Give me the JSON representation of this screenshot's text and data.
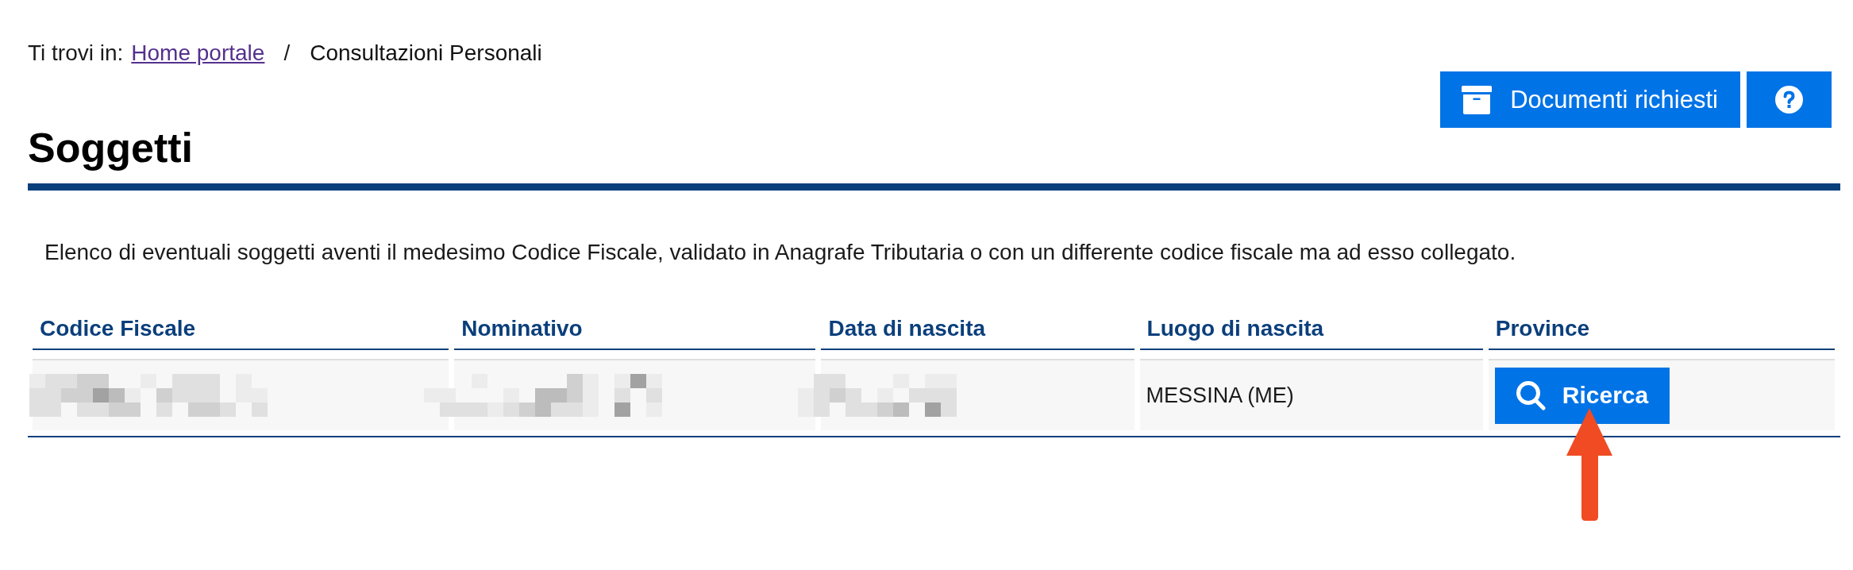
{
  "breadcrumb": {
    "prefix": "Ti trovi in:",
    "separator": "/",
    "items": [
      {
        "kind": "link",
        "label": "Home portale"
      },
      {
        "kind": "current",
        "label": "Consultazioni Personali"
      }
    ]
  },
  "actions": [
    {
      "kind": "documents",
      "label": "Documenti richiesti"
    },
    {
      "kind": "help"
    }
  ],
  "title": "Soggetti",
  "description": "Elenco di eventuali soggetti aventi il medesimo Codice Fiscale, validato in Anagrafe Tributaria o con un differente codice fiscale ma ad esso collegato.",
  "table": {
    "columns": [
      "Codice Fiscale",
      "Nominativo",
      "Data di nascita",
      "Luogo di nascita",
      "Province"
    ],
    "rows": [
      {
        "cells": [
          {
            "kind": "redacted"
          },
          {
            "kind": "redacted"
          },
          {
            "kind": "redacted"
          },
          {
            "kind": "text",
            "text": "MESSINA (ME)"
          },
          {
            "kind": "button",
            "label": "Ricerca",
            "marked": true
          }
        ]
      }
    ]
  }
}
